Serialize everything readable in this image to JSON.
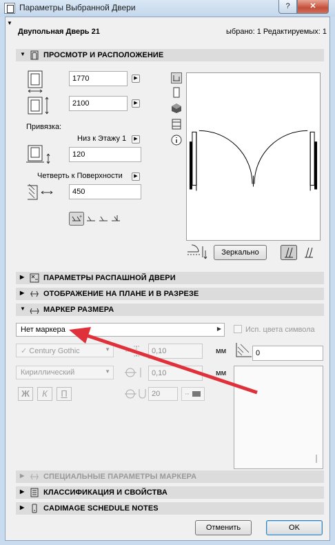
{
  "window": {
    "title": "Параметры Выбранной Двери",
    "help_label": "?",
    "close_label": "✕"
  },
  "header": {
    "door_name": "Двупольная Дверь 21",
    "selection_status": "ыбрано: 1 Редактируемых: 1"
  },
  "sections": {
    "preview_placement": "ПРОСМОТР И РАСПОЛОЖЕНИЕ",
    "swing_door": "ПАРАМЕТРЫ РАСПАШНОЙ ДВЕРИ",
    "plan_section": "ОТОБРАЖЕНИЕ НА ПЛАНЕ И В РАЗРЕЗЕ",
    "dimension_marker": "МАРКЕР РАЗМЕРА",
    "custom_marker": "СПЕЦИАЛЬНЫЕ ПАРАМЕТРЫ МАРКЕРА",
    "classification": "КЛАССИФИКАЦИЯ И СВОЙСТВА",
    "cadimage": "CADIMAGE SCHEDULE NOTES"
  },
  "placement": {
    "width": "1770",
    "height": "2100",
    "anchor_label": "Привязка:",
    "anchor_mode": "Низ к Этажу 1",
    "sill_value": "120",
    "reveal_mode": "Четверть к Поверхности",
    "reveal_value": "450"
  },
  "preview": {
    "mirror_label": "Зеркально"
  },
  "marker": {
    "marker_type": "Нет маркера",
    "use_symbol_colors": "Исп. цвета символа",
    "font": "Century Gothic",
    "font_size": "0,10",
    "unit1": "мм",
    "encoding": "Кириллический",
    "offset": "0,10",
    "unit2": "мм",
    "pen": "20",
    "bold": "Ж",
    "italic": "К",
    "underline": "П",
    "angle": "0"
  },
  "buttons": {
    "cancel": "Отменить",
    "ok": "OK"
  },
  "colors": {
    "annotation_arrow": "#e0303a",
    "title_bar": "#c9dcef"
  }
}
